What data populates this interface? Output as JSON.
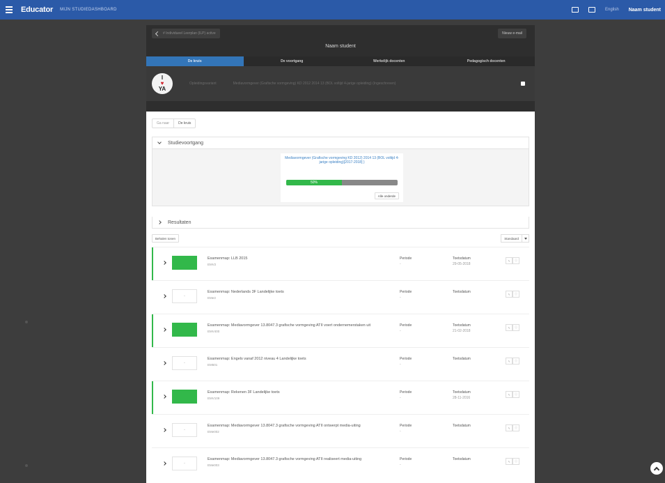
{
  "topbar": {
    "logo": "Educator",
    "nav_title": "MIJN STUDIEDASHBOARD",
    "language": "English",
    "user": "Naam student"
  },
  "student": {
    "selector": "# Individueel Leerplan (ILP) active",
    "new_mail": "Nieuw e-mail",
    "name": "Naam student"
  },
  "tabs": [
    "De kruis",
    "De voortgang",
    "Werkelijk docenten",
    "Pedagogisch docenten"
  ],
  "profile": {
    "badge_line1": "I",
    "badge_heart": "♥",
    "badge_line2": "YA",
    "label": "Opleidingsvariant",
    "value": "Mediavormgever (Grafische vormgeving) KD 2012 2014 13 (BOL voltijd 4-jarige opleiding) (Ingeschreven)"
  },
  "breadcrumbs": [
    "Ga naar",
    "De kruis"
  ],
  "voortgang": {
    "heading": "Studievoortgang",
    "title": "Mediavormgever (Grafische vormgeving KD 2012) 2014 13 (BOL voltijd 4-jarige opleiding)[2017-2018]  )",
    "progress_label": "50%",
    "progress_fraction": 0.5,
    "details_button": "Alle onderde"
  },
  "resultaten": {
    "heading": "Resultaten"
  },
  "toolbar": {
    "left_button": "Behalen tonen",
    "sort_label": "Standaard"
  },
  "rows": [
    {
      "title": "Examenmap: LLB 2015",
      "sub": "EMV2",
      "grade": "",
      "passed": true,
      "period_label": "Periode",
      "period_value": "-",
      "date_label": "Toetsdatum",
      "date_value": "29-05-2018"
    },
    {
      "title": "Examenmap: Nederlands 3F Landelijke toets",
      "sub": "EMe3",
      "grade": "-",
      "passed": false,
      "period_label": "Periode",
      "period_value": "-",
      "date_label": "Toetsdatum",
      "date_value": ""
    },
    {
      "title": "Examenmap: Mediavormgever 13.8047.3 grafische vormgeving ATII voert ondernemerstaken uit",
      "sub": "EMV400",
      "grade": "",
      "passed": true,
      "period_label": "Periode",
      "period_value": "-",
      "date_label": "Toetsdatum",
      "date_value": "21-02-2018"
    },
    {
      "title": "Examenmap: Engels vanaf 2012 niveau 4 Landelijke toets",
      "sub": "EM501",
      "grade": "-",
      "passed": false,
      "period_label": "Periode",
      "period_value": "-",
      "date_label": "Toetsdatum",
      "date_value": ""
    },
    {
      "title": "Examenmap: Rekenen 3F Landelijke toets",
      "sub": "EMV109",
      "grade": "",
      "passed": true,
      "period_label": "Periode",
      "period_value": "-",
      "date_label": "Toetsdatum",
      "date_value": "28-11-2016"
    },
    {
      "title": "Examenmap: Mediavormgever 13.8047.3 grafische vormgeving ATII ontwerpt media-uiting",
      "sub": "EMe002",
      "grade": "-",
      "passed": false,
      "period_label": "Periode",
      "period_value": "-",
      "date_label": "Toetsdatum",
      "date_value": ""
    },
    {
      "title": "Examenmap: Mediavormgever 13.8047.3 grafische vormgeving ATII realiseert media-uiting",
      "sub": "EMe003",
      "grade": "-",
      "passed": false,
      "period_label": "Periode",
      "period_value": "-",
      "date_label": "Toetsdatum",
      "date_value": ""
    }
  ]
}
